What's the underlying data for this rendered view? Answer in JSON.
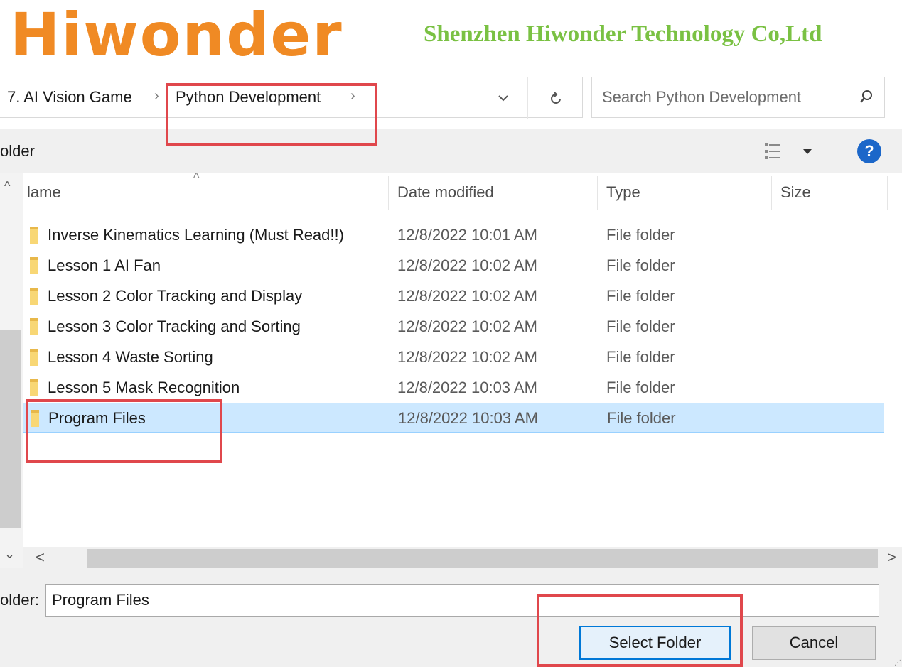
{
  "brand": {
    "logo_text": "Hiwonder",
    "company": "Shenzhen Hiwonder Technology Co,Ltd",
    "logo_color": "#f08a24",
    "company_color": "#7ac143"
  },
  "address_bar": {
    "crumbs": [
      "7. AI Vision Game",
      "Python Development"
    ],
    "separator": "›",
    "dropdown_icon": "chevron-down-icon",
    "refresh_icon": "refresh-icon"
  },
  "search": {
    "placeholder": "Search Python Development",
    "icon": "search-icon"
  },
  "toolbar": {
    "new_folder_label": "older",
    "view_icon": "view-options-icon",
    "help_label": "?",
    "help_color": "#1c67c9"
  },
  "columns": {
    "name": "lame",
    "date": "Date modified",
    "type": "Type",
    "size": "Size"
  },
  "files": [
    {
      "name": "Inverse Kinematics Learning (Must Read!!)",
      "date": "12/8/2022 10:01 AM",
      "type": "File folder",
      "selected": false
    },
    {
      "name": "Lesson 1 AI Fan",
      "date": "12/8/2022 10:02 AM",
      "type": "File folder",
      "selected": false
    },
    {
      "name": "Lesson 2 Color Tracking and Display",
      "date": "12/8/2022 10:02 AM",
      "type": "File folder",
      "selected": false
    },
    {
      "name": "Lesson 3 Color Tracking and Sorting",
      "date": "12/8/2022 10:02 AM",
      "type": "File folder",
      "selected": false
    },
    {
      "name": "Lesson 4 Waste Sorting",
      "date": "12/8/2022 10:02 AM",
      "type": "File folder",
      "selected": false
    },
    {
      "name": "Lesson 5 Mask Recognition",
      "date": "12/8/2022 10:03 AM",
      "type": "File folder",
      "selected": false
    },
    {
      "name": "Program Files",
      "date": "12/8/2022 10:03 AM",
      "type": "File folder",
      "selected": true
    }
  ],
  "bottom": {
    "folder_label": "older:",
    "folder_value": "Program Files",
    "select_label": "Select Folder",
    "cancel_label": "Cancel"
  },
  "colors": {
    "selection": "#cce8ff",
    "highlight": "#e0474c",
    "primary_border": "#0078d7"
  }
}
